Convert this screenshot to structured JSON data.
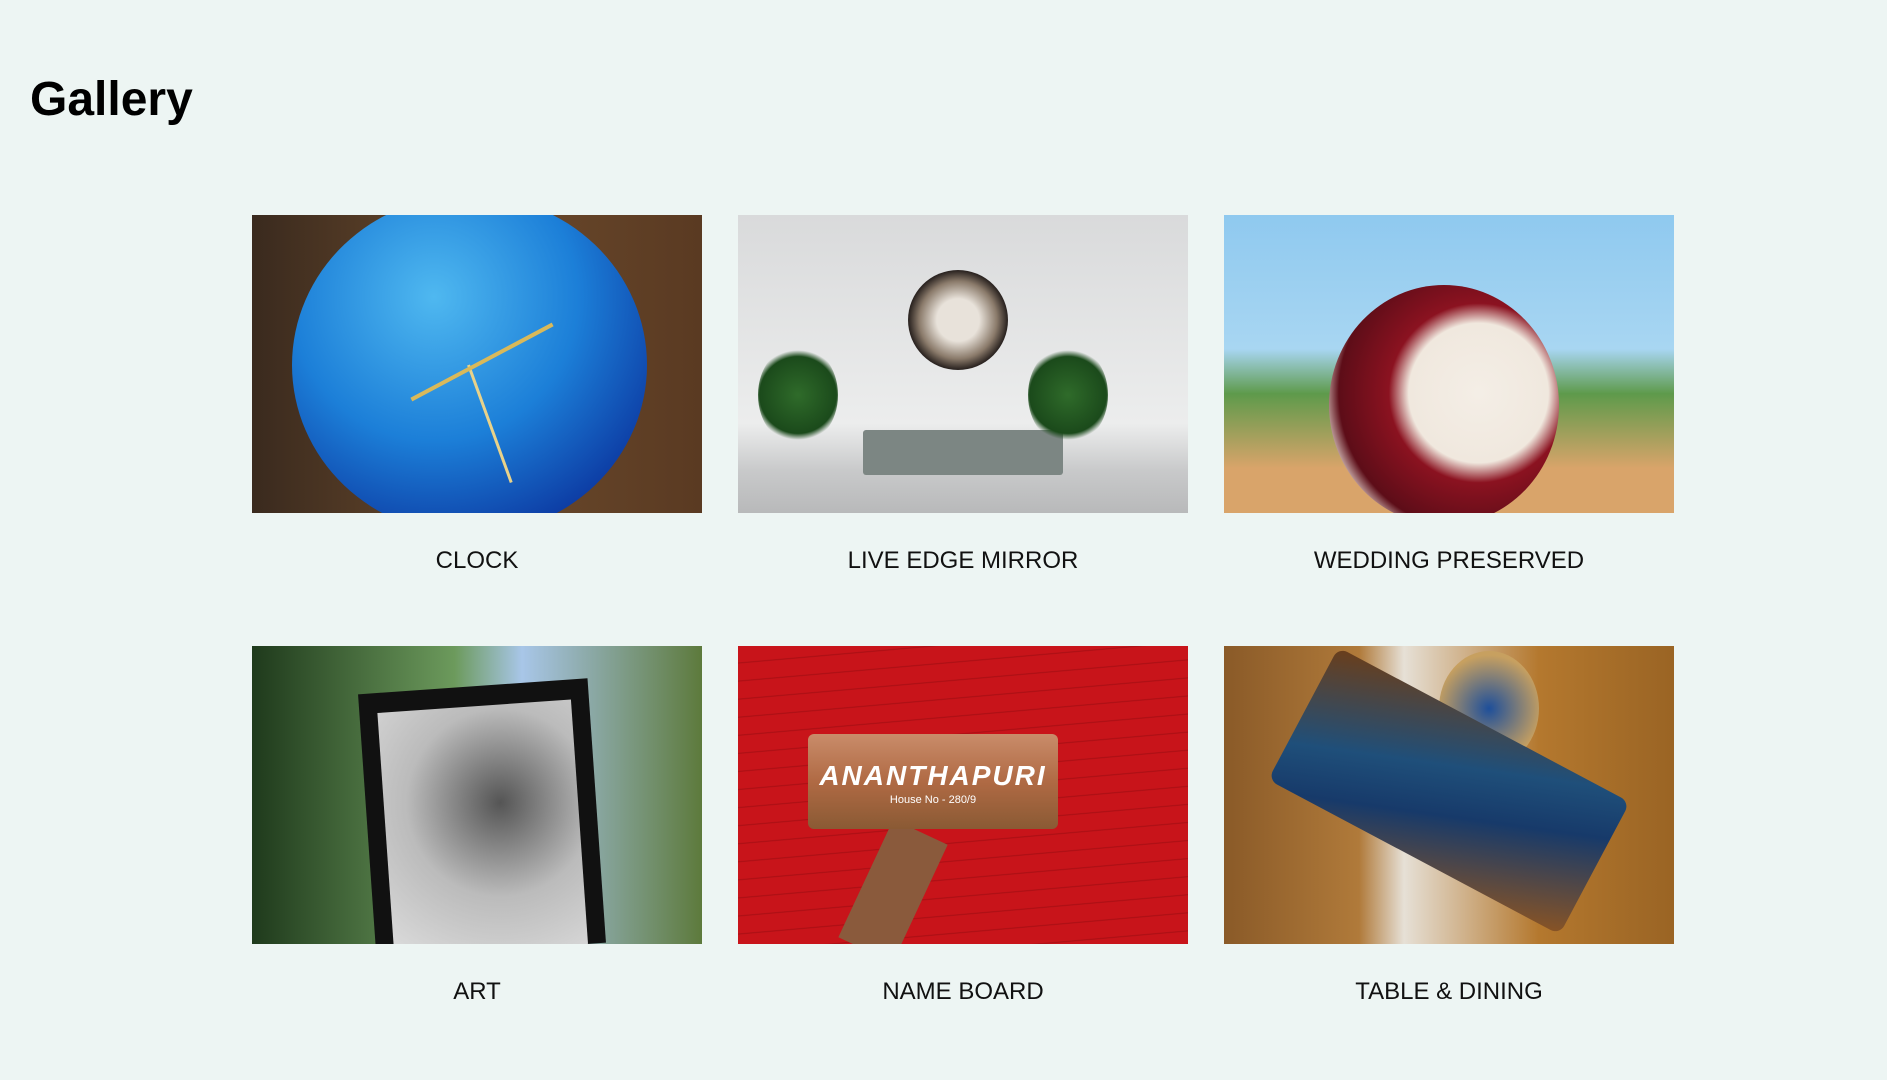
{
  "page": {
    "title": "Gallery"
  },
  "gallery": {
    "items": [
      {
        "label": "CLOCK"
      },
      {
        "label": "LIVE EDGE MIRROR"
      },
      {
        "label": "WEDDING PRESERVED"
      },
      {
        "label": "ART"
      },
      {
        "label": "NAME BOARD",
        "image_text": {
          "name": "ANANTHAPURI",
          "house": "House No - 280/9"
        }
      },
      {
        "label": "TABLE & DINING"
      }
    ]
  }
}
